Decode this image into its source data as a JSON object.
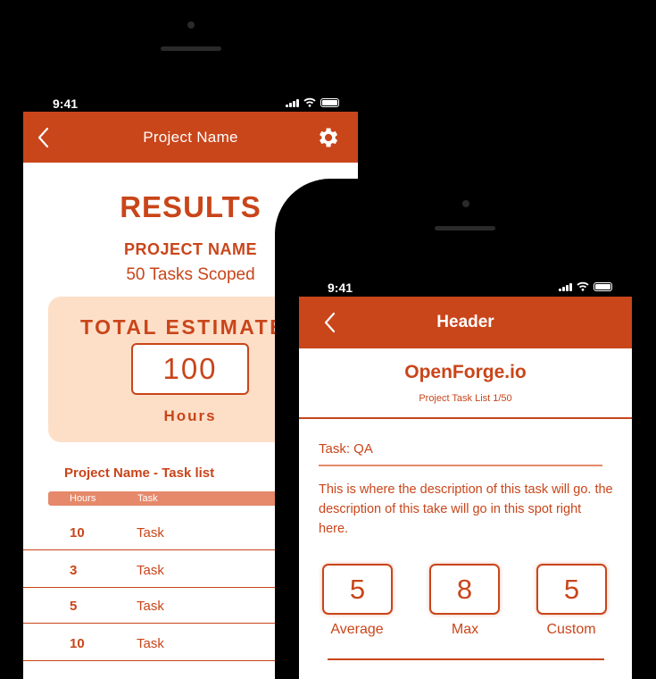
{
  "colors": {
    "brand": "#C9451A",
    "card": "#FDDFC8",
    "table_head": "#E5896A"
  },
  "phone_back": {
    "status": {
      "time": "9:41"
    },
    "nav": {
      "title": "Project Name",
      "back_icon": "chevron-left-icon",
      "settings_icon": "gear-icon"
    },
    "results": {
      "title": "RESULTS",
      "project_name": "PROJECT NAME",
      "tasks_scoped": "50 Tasks Scoped"
    },
    "estimate": {
      "label": "TOTAL ESTIMATE",
      "value": "100",
      "unit": "Hours"
    },
    "task_list": {
      "title": "Project Name - Task list",
      "columns": [
        "Hours",
        "Task"
      ],
      "rows": [
        {
          "hours": "10",
          "task": "Task"
        },
        {
          "hours": "3",
          "task": "Task"
        },
        {
          "hours": "5",
          "task": "Task"
        },
        {
          "hours": "10",
          "task": "Task"
        }
      ]
    }
  },
  "phone_front": {
    "status": {
      "time": "9:41"
    },
    "nav": {
      "title": "Header",
      "back_icon": "chevron-left-icon"
    },
    "brand": "OpenForge.io",
    "counter": "Project Task List 1/50",
    "task": {
      "label": "Task: QA",
      "description": "This is where the description of this task will go. the description of this take will go in this spot right here."
    },
    "estimates": [
      {
        "value": "5",
        "label": "Average"
      },
      {
        "value": "8",
        "label": "Max"
      },
      {
        "value": "5",
        "label": "Custom"
      }
    ]
  }
}
